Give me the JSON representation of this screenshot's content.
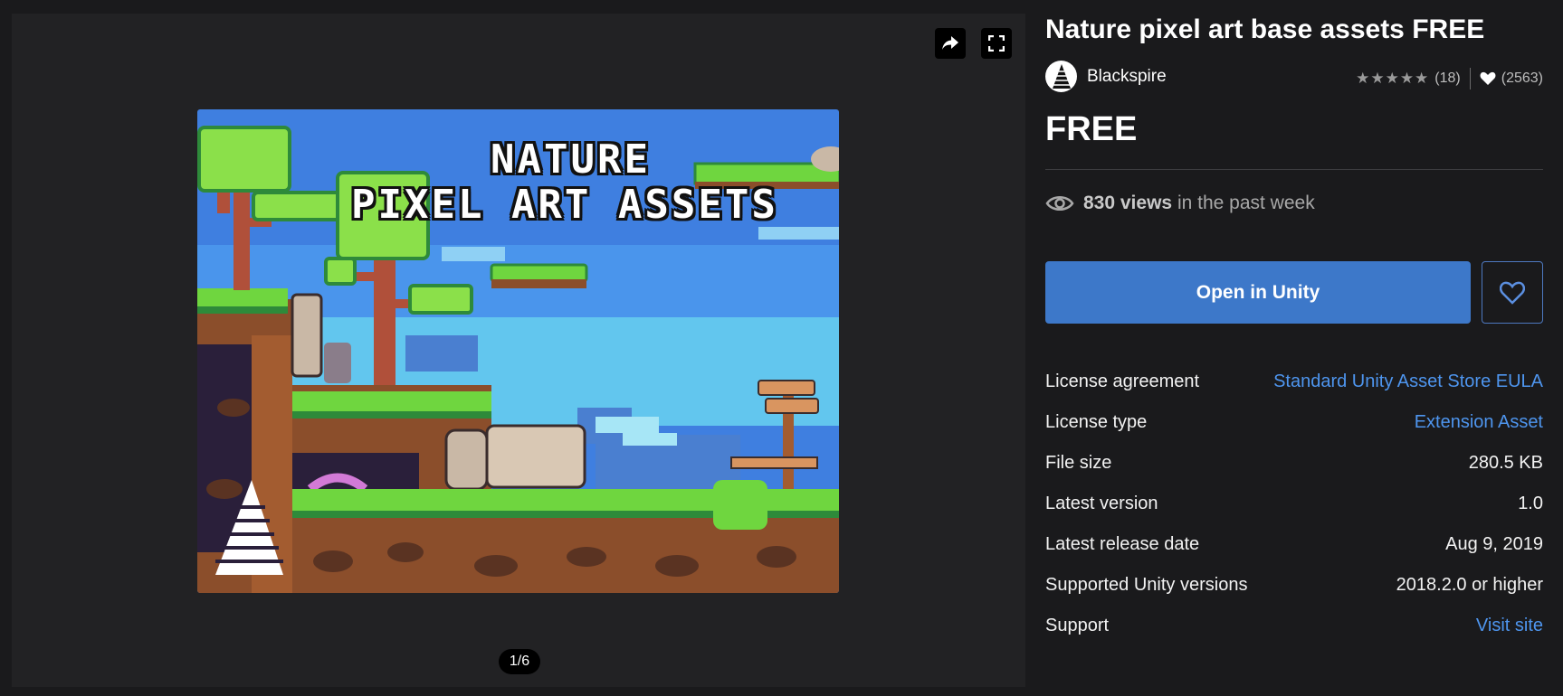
{
  "gallery": {
    "pager": "1/6",
    "share_icon": "share-arrow-icon",
    "fullscreen_icon": "fullscreen-icon",
    "artwork_title_line1": "NATURE",
    "artwork_title_line2": "PIXEL ART ASSETS"
  },
  "product": {
    "title": "Nature pixel art base assets FREE",
    "publisher": "Blackspire",
    "rating_stars": "★★★★★",
    "rating_count": "(18)",
    "favorites_count": "(2563)",
    "price": "FREE",
    "views_count": "830 views",
    "views_suffix": "in the past week"
  },
  "actions": {
    "open_label": "Open in Unity"
  },
  "details": [
    {
      "label": "License agreement",
      "value": "Standard Unity Asset Store EULA",
      "link": true
    },
    {
      "label": "License type",
      "value": "Extension Asset",
      "link": true
    },
    {
      "label": "File size",
      "value": "280.5 KB",
      "link": false
    },
    {
      "label": "Latest version",
      "value": "1.0",
      "link": false
    },
    {
      "label": "Latest release date",
      "value": "Aug 9, 2019",
      "link": false
    },
    {
      "label": "Supported Unity versions",
      "value": "2018.2.0 or higher",
      "link": false
    },
    {
      "label": "Support",
      "value": "Visit site",
      "link": true
    }
  ],
  "colors": {
    "accent": "#3d78c9",
    "link": "#4e95ee",
    "background": "#1a1a1c",
    "panel": "#222224"
  }
}
